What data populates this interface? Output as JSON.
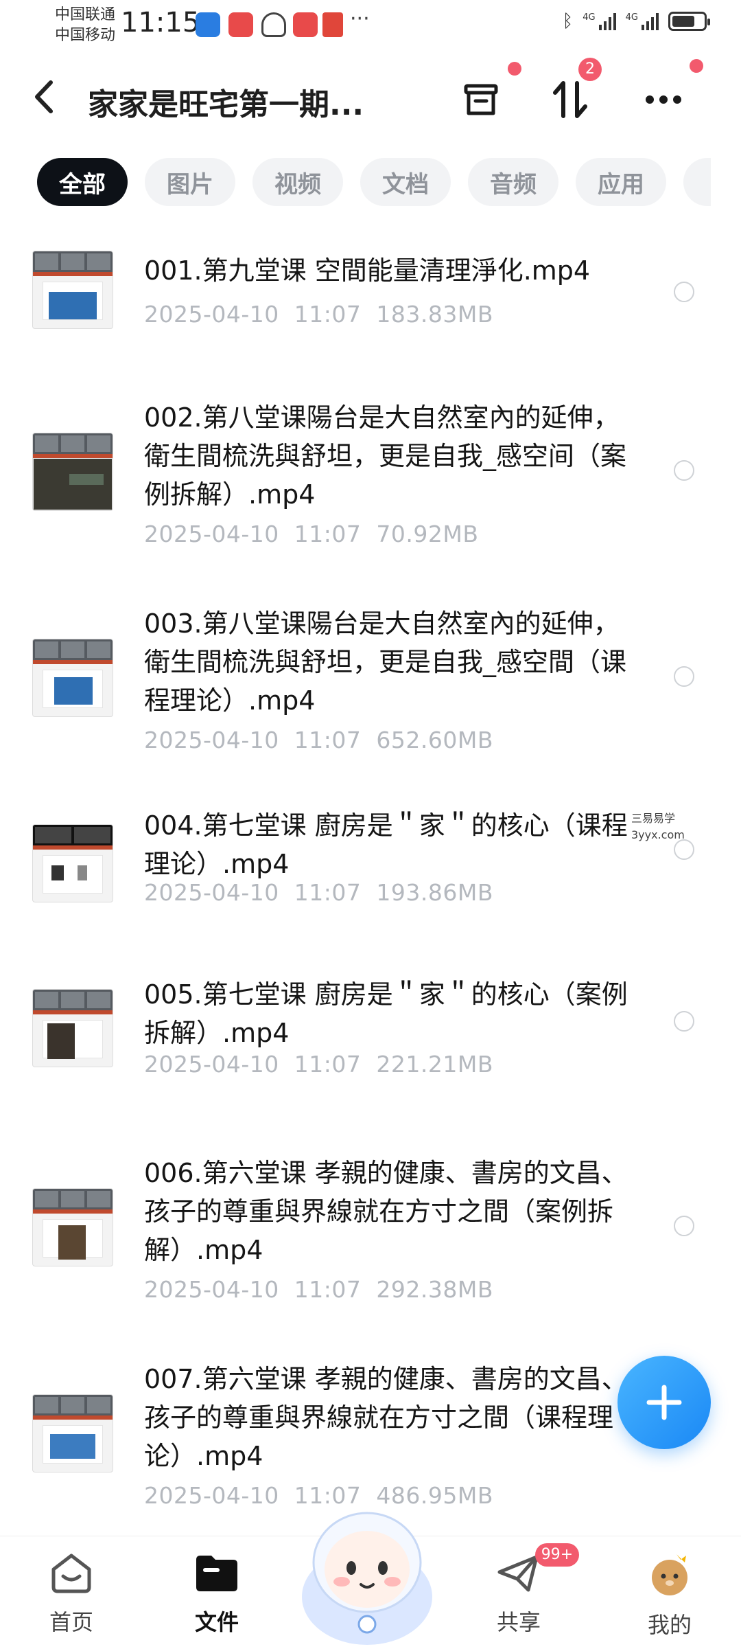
{
  "status_bar": {
    "carrier1": "中国联通",
    "carrier2": "中国移动",
    "time": "11:15",
    "more": "···",
    "network1": "4G",
    "network2": "4G"
  },
  "header": {
    "back_icon": "chevron-left-icon",
    "title": "家家是旺宅第一期...",
    "transfer_badge": "2"
  },
  "tabs": [
    {
      "label": "全部",
      "active": true
    },
    {
      "label": "图片",
      "active": false
    },
    {
      "label": "视频",
      "active": false
    },
    {
      "label": "文档",
      "active": false
    },
    {
      "label": "音频",
      "active": false
    },
    {
      "label": "应用",
      "active": false
    }
  ],
  "files": [
    {
      "name": "001.第九堂课 空間能量清理淨化.mp4",
      "date": "2025-04-10",
      "time": "11:07",
      "size": "183.83MB"
    },
    {
      "name": "002.第八堂课陽台是大自然室內的延伸，衛生間梳洗與舒坦，更是自我_感空间（案例拆解）.mp4",
      "date": "2025-04-10",
      "time": "11:07",
      "size": "70.92MB"
    },
    {
      "name": "003.第八堂课陽台是大自然室內的延伸，衛生間梳洗與舒坦，更是自我_感空間（课程理论）.mp4",
      "date": "2025-04-10",
      "time": "11:07",
      "size": "652.60MB"
    },
    {
      "name": "004.第七堂课 廚房是＂家＂的核心（课程理论）.mp4",
      "date": "2025-04-10",
      "time": "11:07",
      "size": "193.86MB"
    },
    {
      "name": "005.第七堂课 廚房是＂家＂的核心（案例拆解）.mp4",
      "date": "2025-04-10",
      "time": "11:07",
      "size": "221.21MB"
    },
    {
      "name": "006.第六堂课 孝親的健康、書房的文昌、孩子的尊重與界線就在方寸之間（案例拆解）.mp4",
      "date": "2025-04-10",
      "time": "11:07",
      "size": "292.38MB"
    },
    {
      "name": "007.第六堂课 孝親的健康、書房的文昌、孩子的尊重與界線就在方寸之間（课程理论）.mp4",
      "date": "2025-04-10",
      "time": "11:07",
      "size": "486.95MB"
    }
  ],
  "watermark": {
    "line1": "三易易学",
    "line2": "3yyx.com"
  },
  "fab": {
    "label": "+"
  },
  "bottom_nav": [
    {
      "label": "首页",
      "icon": "home-icon",
      "active": false
    },
    {
      "label": "文件",
      "icon": "folder-icon",
      "active": true
    },
    {
      "label": "",
      "icon": "mascot-icon",
      "active": false
    },
    {
      "label": "共享",
      "icon": "share-plane-icon",
      "active": false,
      "badge": "99+"
    },
    {
      "label": "我的",
      "icon": "avatar-icon",
      "active": false
    }
  ],
  "colors": {
    "accent": "#1a88f5",
    "badge": "#f25a6d",
    "active_tab": "#0d1117"
  }
}
